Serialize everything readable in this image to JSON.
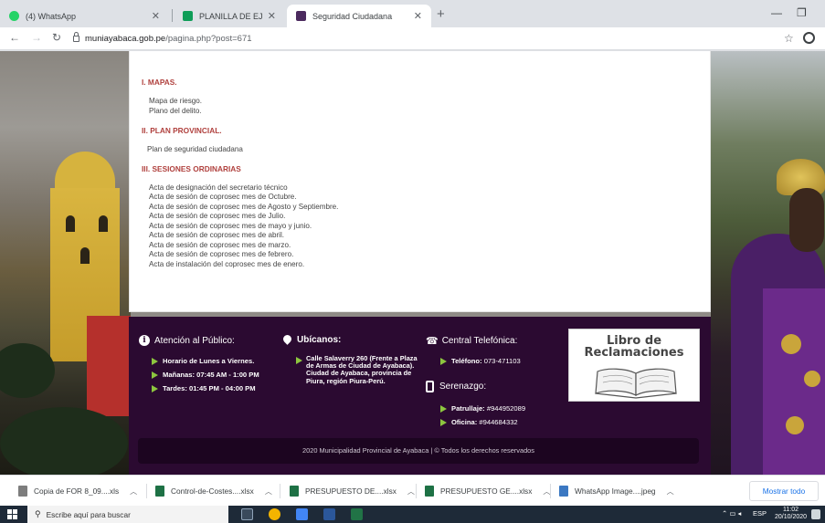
{
  "browser": {
    "tabs": [
      {
        "title": "(4) WhatsApp",
        "favicon_color": "#25d366"
      },
      {
        "title": "PLANILLA DE EJECUCION DE GA",
        "favicon_color": "#0f9d58"
      },
      {
        "title": "Seguridad Ciudadana",
        "favicon_color": "#4b2a5e"
      }
    ],
    "new_tab_icon": "plus-icon",
    "url_domain": "muniayabaca.gob.pe",
    "url_path": "/pagina.php?post=671"
  },
  "content": {
    "sections": [
      {
        "title": "I. MAPAS.",
        "items": [
          "Mapa de riesgo.",
          "Plano del delito."
        ]
      },
      {
        "title": "II. PLAN PROVINCIAL.",
        "items": [
          "Plan de seguridad ciudadana"
        ]
      },
      {
        "title": "III. SESIONES ORDINARIAS",
        "items": [
          "Acta de designación del secretario técnico",
          "Acta de sesión de coprosec mes de Octubre.",
          "Acta de sesión de coprosec mes de Agosto y Septiembre.",
          "Acta de sesión de coprosec mes de Julio.",
          "Acta de sesión de coprosec mes de mayo y junio.",
          "Acta de sesión de coprosec mes de abril.",
          "Acta de sesión de coprosec mes de marzo.",
          "Acta de sesión de coprosec mes de febrero.",
          "Acta de instalación del coprosec mes de enero."
        ]
      }
    ]
  },
  "footer": {
    "attention": {
      "title": "Atención al Público:",
      "items": [
        "Horario de Lunes a Viernes.",
        "Mañanas: 07:45 AM - 1:00 PM",
        "Tardes: 01:45 PM - 04:00 PM"
      ]
    },
    "location": {
      "title": "Ubícanos:",
      "address": "Calle Salaverry 260 (Frente a Plaza de Armas de Ciudad de Ayabaca). Ciudad de Ayabaca, provincia de Piura, región Piura-Perú."
    },
    "phone": {
      "title": "Central Telefónica:",
      "label": "Teléfono:",
      "value": "073-471103"
    },
    "serenazgo": {
      "title": "Serenazgo:",
      "patrol_label": "Patrullaje:",
      "patrol_value": "#944952089",
      "office_label": "Oficina:",
      "office_value": "#944684332"
    },
    "book": {
      "line1": "Libro de",
      "line2": "Reclamaciones"
    },
    "copyright": "2020 Municipalidad Provincial de Ayabaca | © Todos los derechos reservados"
  },
  "downloads": {
    "items": [
      {
        "name": "Copia de FOR 8_09....xls",
        "color": "#7d7d7d"
      },
      {
        "name": "Control-de-Costes....xlsx",
        "color": "#1e7145"
      },
      {
        "name": "PRESUPUESTO DE....xlsx",
        "color": "#1e7145"
      },
      {
        "name": "PRESUPUESTO GE....xlsx",
        "color": "#1e7145"
      },
      {
        "name": "WhatsApp Image....jpeg",
        "color": "#3b78c2"
      }
    ],
    "show_all": "Mostrar todo"
  },
  "taskbar": {
    "search_placeholder": "Escribe aquí para buscar",
    "language": "ESP",
    "time": "11:02",
    "date": "20/10/2020"
  }
}
